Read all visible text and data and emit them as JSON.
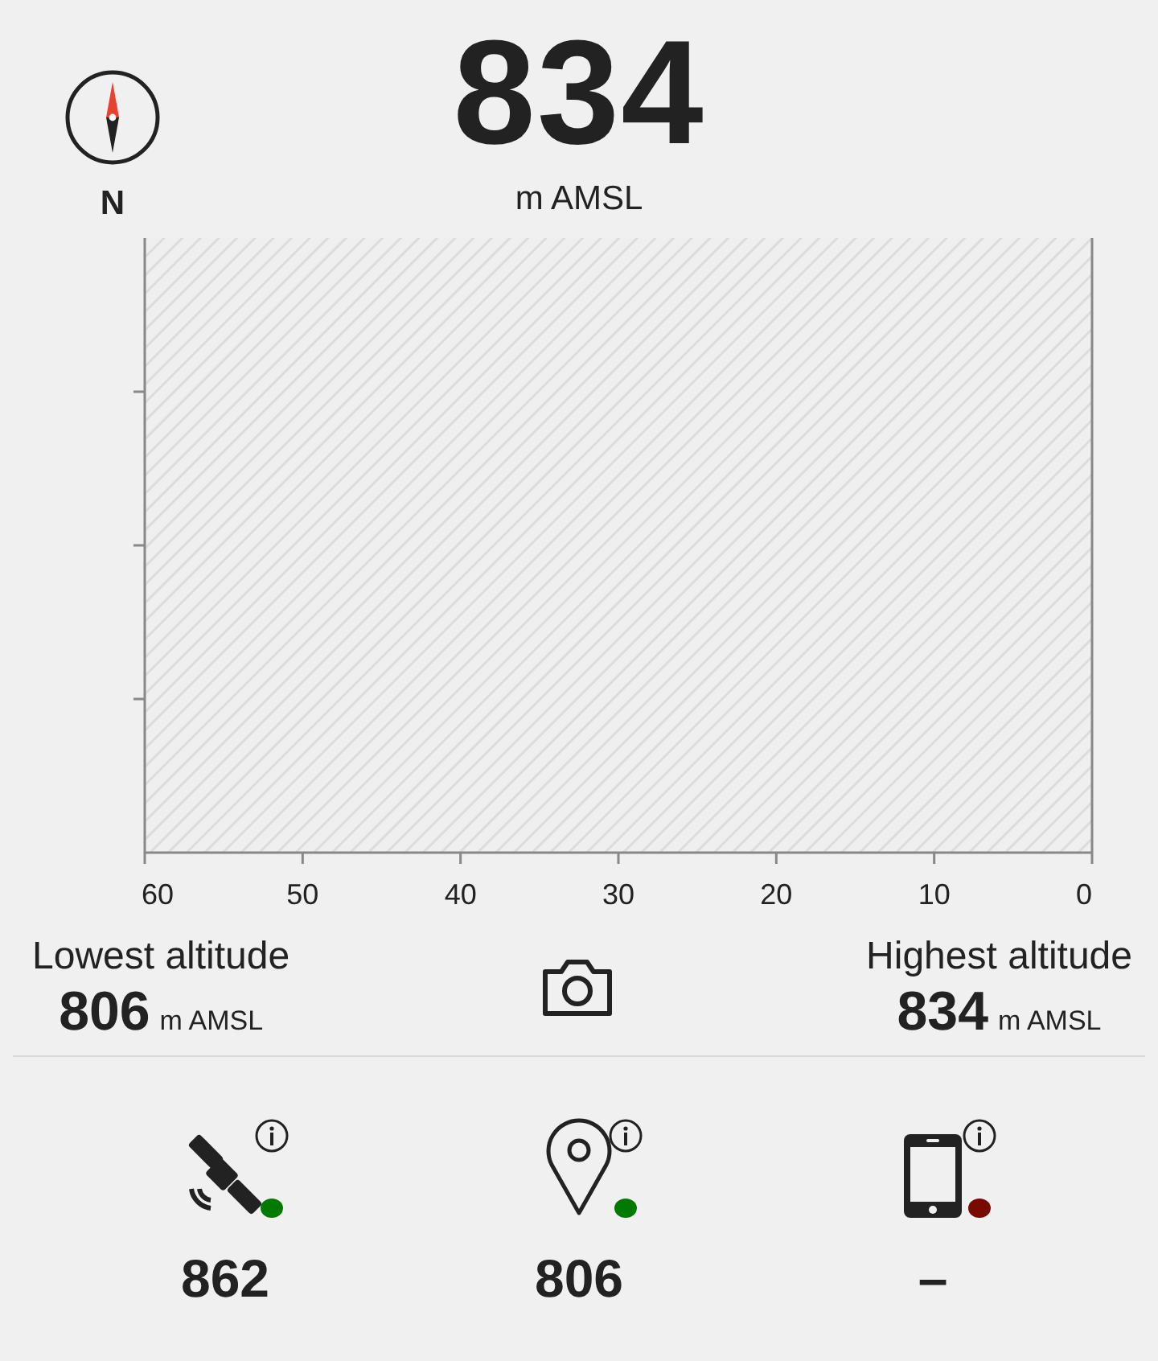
{
  "heading": {
    "direction": "N",
    "altitude": "834",
    "unit": "m AMSL"
  },
  "graph": {
    "x_ticks": [
      "60",
      "50",
      "40",
      "30",
      "20",
      "10",
      "0"
    ]
  },
  "stats": [
    {
      "label": "Lowest altitude",
      "value": "806",
      "unit": "m AMSL"
    },
    {
      "label": "Highest altitude",
      "value": "834",
      "unit": "m AMSL"
    }
  ],
  "sources": [
    {
      "kind": "satellite",
      "value": "862",
      "color": "#007a00"
    },
    {
      "kind": "location",
      "value": "806",
      "color": "#007a00"
    },
    {
      "kind": "phone",
      "value": "–",
      "color": "#7a0a00"
    }
  ]
}
